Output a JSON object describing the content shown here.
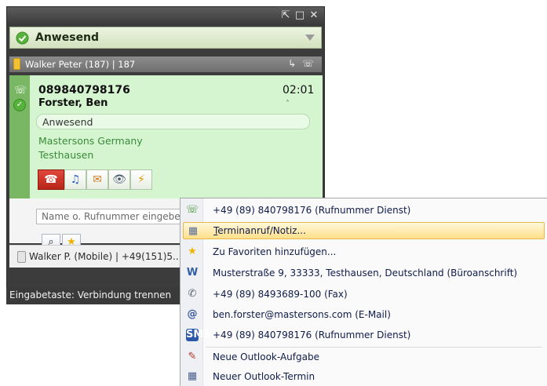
{
  "window": {
    "buttons": {
      "pin": "⇱",
      "restore": "□",
      "close": "✕"
    }
  },
  "status": {
    "label": "Anwesend"
  },
  "line": {
    "label": "Walker Peter (187) | 187",
    "forward_icon": "↳ ☏"
  },
  "call": {
    "number": "089840798176",
    "duration": "02:01",
    "name": "Forster, Ben",
    "presence": "Anwesend",
    "company": "Mastersons Germany",
    "city": "Testhausen",
    "collapse_icon": "˄"
  },
  "call_actions": [
    {
      "name": "hangup",
      "glyph": "☎"
    },
    {
      "name": "music-hold",
      "glyph": "♫"
    },
    {
      "name": "transfer",
      "glyph": "✉"
    },
    {
      "name": "monitor",
      "glyph": "👁"
    },
    {
      "name": "flash",
      "glyph": "⚡"
    }
  ],
  "search": {
    "placeholder": "Name o. Rufnummer eingeben"
  },
  "contact_row": {
    "label": "Walker P. (Mobile)  | +49(151)5..."
  },
  "hint": {
    "text": "Eingabetaste: Verbindung trennen"
  },
  "menu": {
    "items": [
      {
        "icon": "phone-icon",
        "glyph": "☏",
        "label": "+49 (89) 840798176 (Rufnummer Dienst)"
      },
      {
        "icon": "calendar-icon",
        "glyph": "▦",
        "label": "Terminanruf/Notiz..."
      },
      {
        "icon": "star-icon",
        "glyph": "★",
        "label": "Zu Favoriten hinzufügen..."
      },
      {
        "icon": "address-icon",
        "glyph": "W",
        "label": "Musterstraße 9, 33333, Testhausen, Deutschland (Büroanschrift)"
      },
      {
        "icon": "fax-icon",
        "glyph": "✆",
        "label": "+49 (89) 8493689-100 (Fax)"
      },
      {
        "icon": "email-icon",
        "glyph": "@",
        "label": "ben.forster@mastersons.com (E-Mail)"
      },
      {
        "icon": "sms-icon",
        "glyph": "SMS",
        "label": "+49 (89) 840798176 (Rufnummer Dienst)"
      },
      {
        "icon": "task-icon",
        "glyph": "✎",
        "label": "Neue Outlook-Aufgabe"
      },
      {
        "icon": "appointment-icon",
        "glyph": "▦",
        "label": "Neuer Outlook-Termin"
      }
    ]
  },
  "colors": {
    "call_panel": "#d4f5cf",
    "menu_highlight": "#ffe08a",
    "status_green": "#56b23a"
  }
}
